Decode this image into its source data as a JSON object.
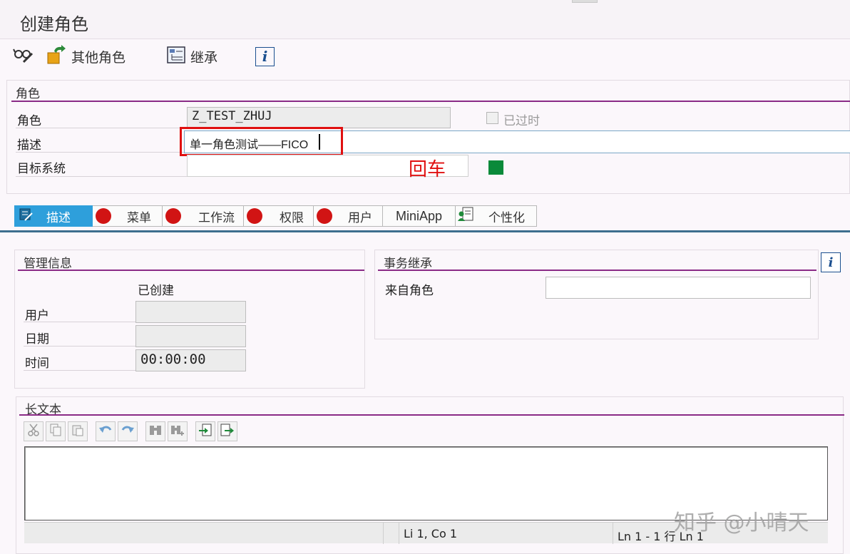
{
  "window": {
    "title": "创建角色"
  },
  "toolbar": {
    "other_roles": "其他角色",
    "inherit": "继承",
    "info": "i"
  },
  "role_section": {
    "title": "角色",
    "role_label": "角色",
    "role_value": "Z_TEST_ZHUJ",
    "expired_label": "已过时",
    "desc_label": "描述",
    "desc_value": "单一角色测试——FICO",
    "target_label": "目标系统",
    "target_value": "",
    "annotation": "回车",
    "status_color": "#0a8a3a"
  },
  "tabs": [
    {
      "label": "描述",
      "active": true,
      "icon": "description-icon"
    },
    {
      "label": "菜单",
      "status": "red"
    },
    {
      "label": "工作流",
      "status": "red"
    },
    {
      "label": "权限",
      "status": "red"
    },
    {
      "label": "用户",
      "status": "red"
    },
    {
      "label": "MiniApp"
    },
    {
      "label": "个性化",
      "icon": "personalization-icon"
    }
  ],
  "admin_info": {
    "title": "管理信息",
    "created_label": "已创建",
    "user_label": "用户",
    "user_value": "",
    "date_label": "日期",
    "date_value": "",
    "time_label": "时间",
    "time_value": "00:00:00"
  },
  "inheritance": {
    "title": "事务继承",
    "from_role_label": "来自角色",
    "from_role_value": ""
  },
  "long_text": {
    "title": "长文本",
    "status_position": "Li 1, Co 1",
    "status_lines": "Ln 1 - 1 行 Ln 1"
  },
  "watermark": "知乎 @小晴天",
  "colors": {
    "accent_line": "#8a2a86",
    "tab_active": "#2e9fdb",
    "highlight_box": "#e01010",
    "annotation_text": "#e01010"
  }
}
